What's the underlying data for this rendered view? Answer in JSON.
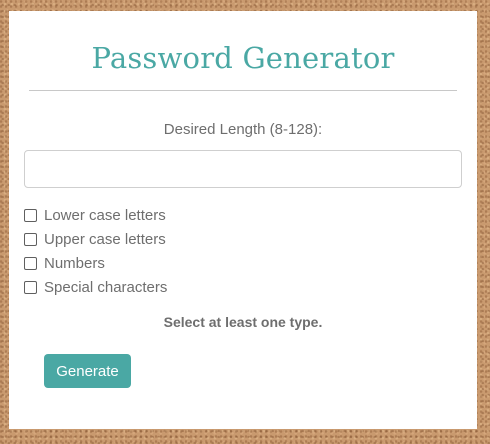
{
  "app": {
    "title": "Password Generator"
  },
  "length": {
    "label": "Desired Length (8-128):",
    "value": "",
    "placeholder": ""
  },
  "options": [
    {
      "label": "Lower case letters",
      "checked": false
    },
    {
      "label": "Upper case letters",
      "checked": false
    },
    {
      "label": "Numbers",
      "checked": false
    },
    {
      "label": "Special characters",
      "checked": false
    }
  ],
  "hint": "Select at least one type.",
  "actions": {
    "generate_label": "Generate"
  },
  "colors": {
    "accent": "#4aa8a4",
    "text": "#6e6e6e",
    "background": "#c99a6f"
  }
}
